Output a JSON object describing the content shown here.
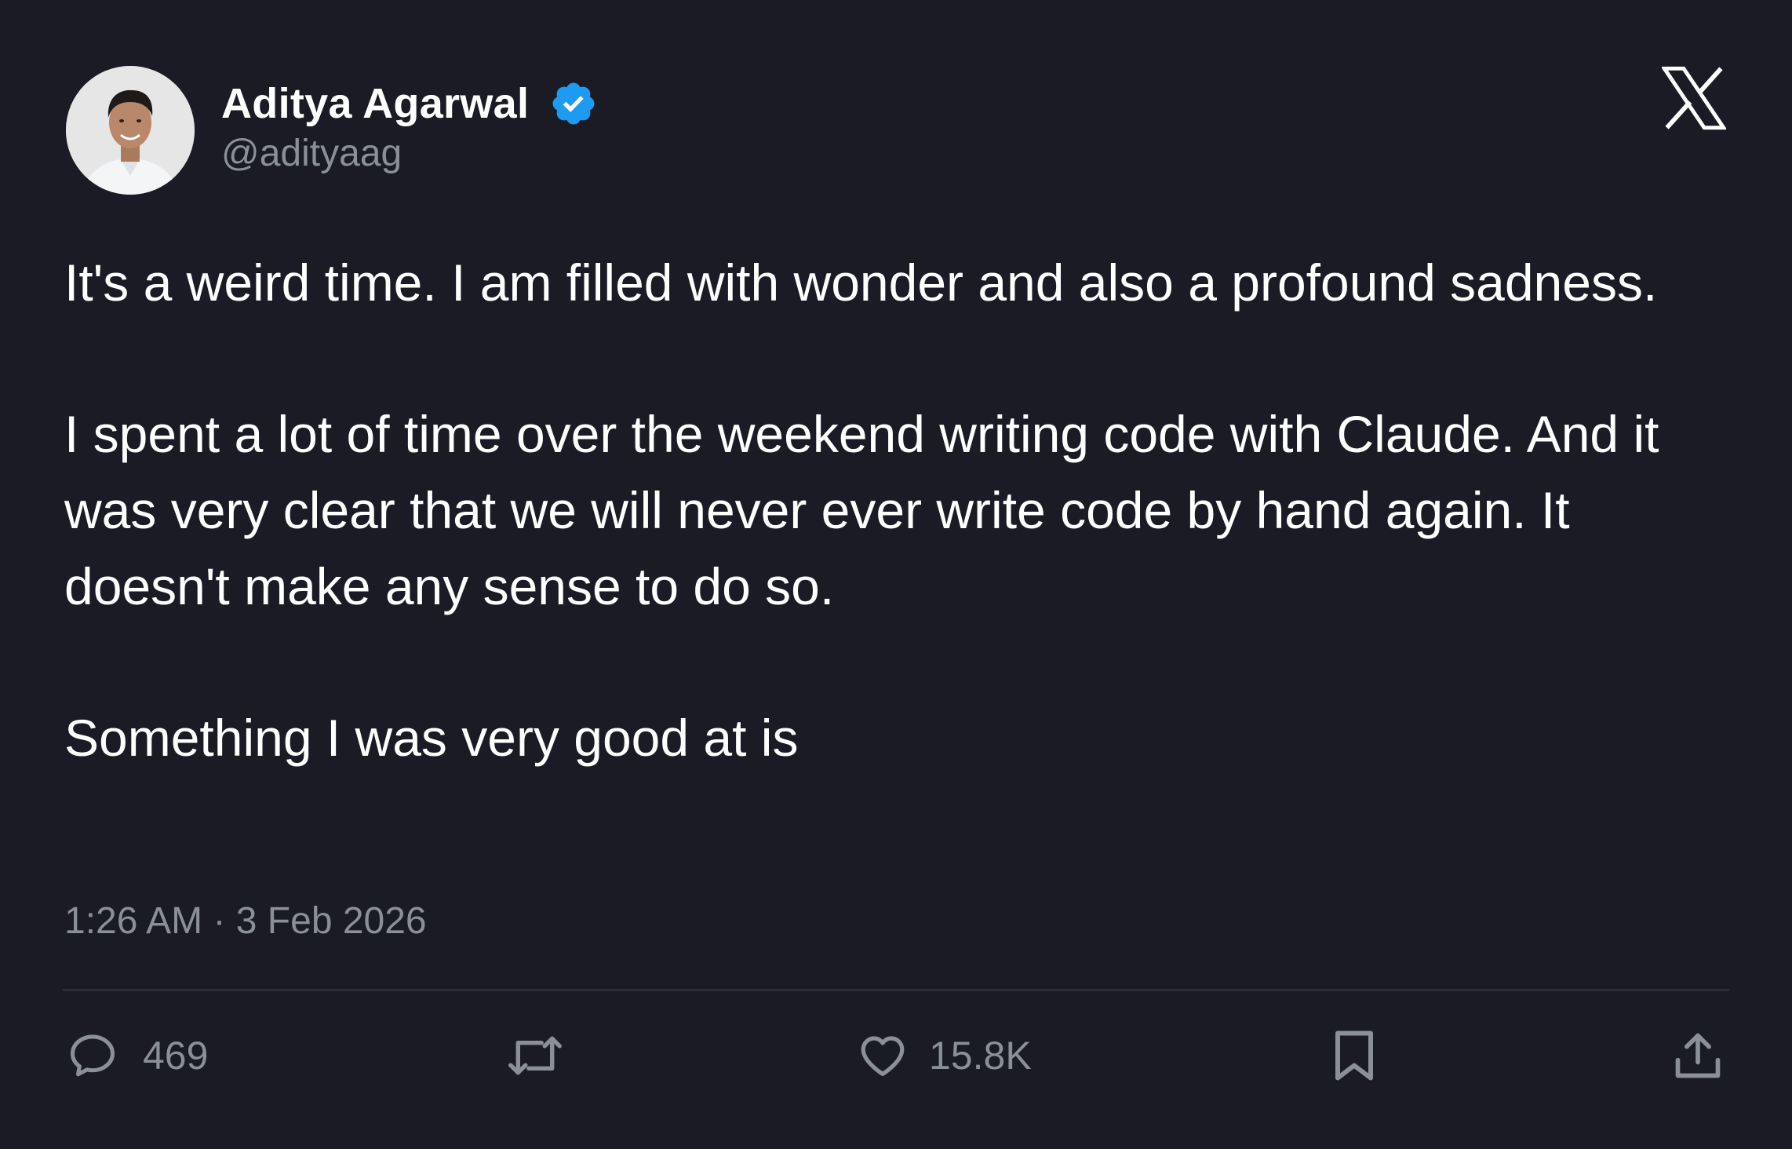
{
  "author": {
    "name": "Aditya Agarwal",
    "handle": "@adityaag",
    "verified": true,
    "verified_color": "#1d9bf0"
  },
  "tweet": {
    "paragraphs": [
      "It's a weird time. I am filled with wonder and also a profound sadness.",
      "I spent a lot of time over the weekend writing code with Claude. And it was very clear that we will never ever write code by hand again. It doesn't make any sense to do so.",
      "Something I was very good at is"
    ],
    "timestamp": "1:26 AM · 3 Feb 2026"
  },
  "actions": {
    "reply_count": "469",
    "like_count": "15.8K"
  },
  "icons": {
    "brand": "x-logo-icon",
    "reply": "speech-bubble-icon",
    "retweet": "retweet-icon",
    "like": "heart-icon",
    "bookmark": "bookmark-icon",
    "share": "share-upload-icon"
  },
  "colors": {
    "background": "#1a1b24",
    "text": "#ffffff",
    "muted": "#8b8f98"
  }
}
